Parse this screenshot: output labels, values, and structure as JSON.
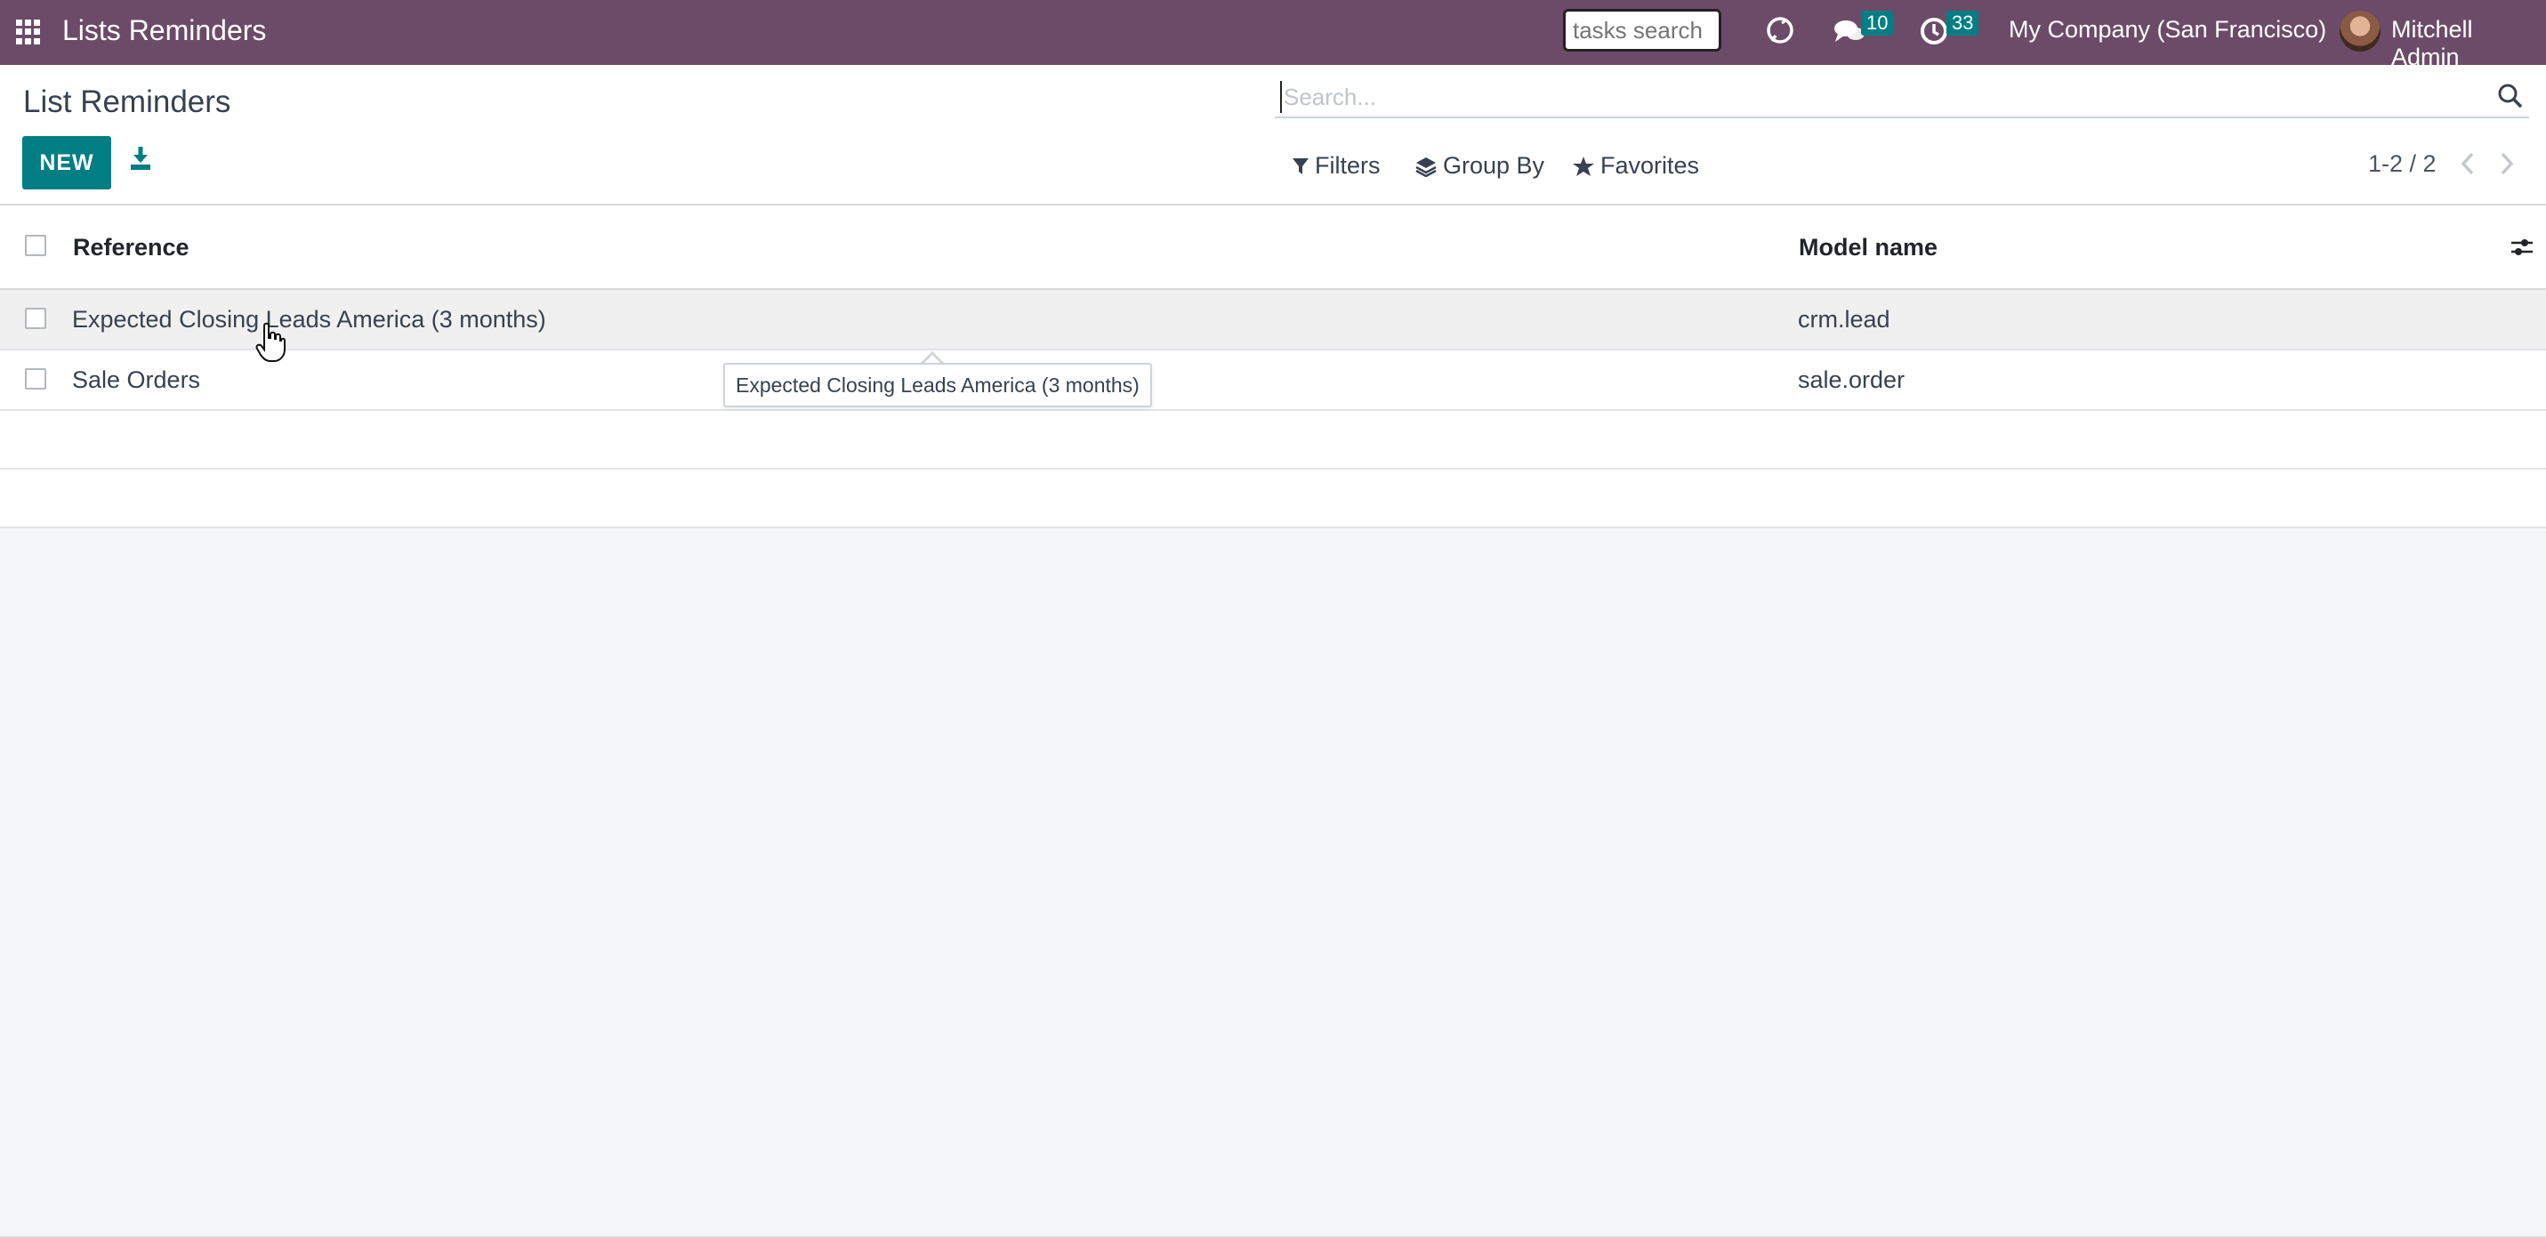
{
  "navbar": {
    "app_title": "Lists Reminders",
    "tasks_search_placeholder": "tasks search",
    "messages_badge": "10",
    "activities_badge": "33",
    "company": "My Company (San Francisco)",
    "user": "Mitchell Admin",
    "color": "#6c4b68"
  },
  "control_panel": {
    "title": "List Reminders",
    "new_label": "NEW",
    "search_placeholder": "Search...",
    "filters_label": "Filters",
    "group_by_label": "Group By",
    "favorites_label": "Favorites",
    "pager": "1-2 / 2",
    "accent": "#017e84"
  },
  "list": {
    "columns": [
      "Reference",
      "Model name"
    ],
    "rows": [
      {
        "reference": "Expected Closing Leads America (3 months)",
        "model": "crm.lead"
      },
      {
        "reference": "Sale Orders",
        "model": "sale.order"
      }
    ]
  },
  "tooltip": {
    "text": "Expected Closing Leads America (3 months)"
  }
}
